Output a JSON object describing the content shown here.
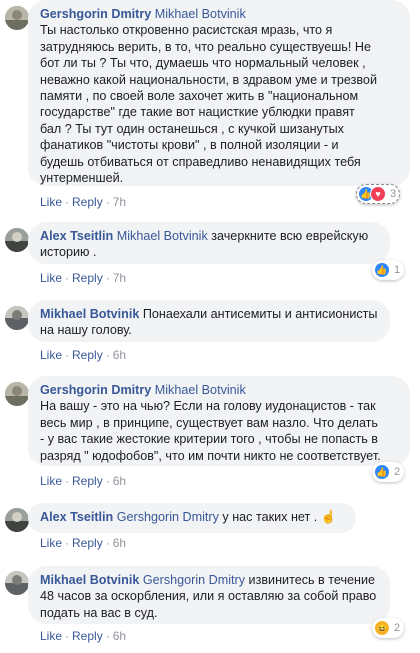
{
  "comments": [
    {
      "author": "Gershgorin Dmitry",
      "mention": "Mikhael Botvinik",
      "lines": [
        "Ты настолько откровенно расистская мразь, что я",
        "затрудняюсь верить, в то, что реально существуешь! Не",
        "бот ли ты ? Ты что, думаешь что нормальный человек ,",
        "неважно какой национальности, в здравом уме и трезвой",
        "памяти , по своей воле захочет жить в \"национальном",
        "государстве\" где такие вот нацисткие ублюдки правят",
        "бал ? Ты тут один останешься , с кучкой шизанутых",
        "фанатиков \"чистоты крови\" , в полной изоляции - и",
        "будешь отбиваться от справедливо ненавидящих тебя",
        "унтерменшей."
      ],
      "like": "Like",
      "reply": "Reply",
      "time": "7h",
      "reaction_count": "3"
    },
    {
      "author": "Alex Tseitlin",
      "mention": "Mikhael Botvinik",
      "lines": [
        " зачеркните всю еврейскую",
        "историю ."
      ],
      "like": "Like",
      "reply": "Reply",
      "time": "7h",
      "reaction_count": "1"
    },
    {
      "author": "Mikhael Botvinik",
      "mention": "",
      "lines": [
        " Понаехали антисемиты и антисионисты",
        "на нашу голову."
      ],
      "like": "Like",
      "reply": "Reply",
      "time": "6h",
      "reaction_count": ""
    },
    {
      "author": "Gershgorin Dmitry",
      "mention": "Mikhael Botvinik",
      "lines": [
        "На вашу - это на чью? Если на голову иудонацистов - так",
        "весь мир , в принципе, существует вам назло. Что делать",
        "- у вас такие жестокие критерии того , чтобы не попасть в",
        "разряд \" юдофобов\", что им почти никто не соответствует."
      ],
      "like": "Like",
      "reply": "Reply",
      "time": "6h",
      "reaction_count": "2"
    },
    {
      "author": "Alex Tseitlin",
      "mention": "Gershgorin Dmitry",
      "lines": [
        " у нас таких нет . "
      ],
      "emoji": "☝",
      "like": "Like",
      "reply": "Reply",
      "time": "6h",
      "reaction_count": ""
    },
    {
      "author": "Mikhael Botvinik",
      "mention": "Gershgorin Dmitry",
      "lines": [
        " извинитесь в течение",
        "48 часов за оскорбления, или я оставляю за собой право",
        "подать на вас в суд."
      ],
      "like": "Like",
      "reply": "Reply",
      "time": "6h",
      "reaction_count": "2"
    }
  ],
  "colors": {
    "link": "#385898",
    "bubble": "#f2f3f5",
    "meta": "#90949c",
    "like": "#2d88ff",
    "love": "#f33e58",
    "haha": "#f7b125"
  }
}
